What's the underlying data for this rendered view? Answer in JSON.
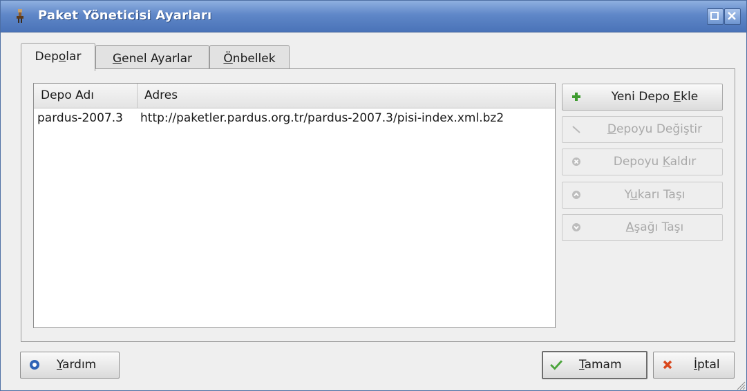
{
  "window": {
    "title": "Paket Yöneticisi Ayarları"
  },
  "tabs": [
    {
      "pre": "Dep",
      "key": "o",
      "post": "lar"
    },
    {
      "pre": "",
      "key": "G",
      "post": "enel Ayarlar"
    },
    {
      "pre": "",
      "key": "Ö",
      "post": "nbellek"
    }
  ],
  "repo_table": {
    "columns": [
      "Depo Adı",
      "Adres"
    ],
    "rows": [
      {
        "name": "pardus-2007.3",
        "address": "http://paketler.pardus.org.tr/pardus-2007.3/pisi-index.xml.bz2"
      }
    ]
  },
  "actions": [
    {
      "pre": "Yeni Depo ",
      "key": "E",
      "post": "kle",
      "icon": "plus-icon",
      "enabled": true
    },
    {
      "pre": "",
      "key": "D",
      "post": "epoyu Değiştir",
      "icon": "edit-icon",
      "enabled": false
    },
    {
      "pre": "Depoyu ",
      "key": "K",
      "post": "aldır",
      "icon": "remove-icon",
      "enabled": false
    },
    {
      "pre": "Y",
      "key": "u",
      "post": "karı Taşı",
      "icon": "arrow-up-icon",
      "enabled": false
    },
    {
      "pre": "",
      "key": "A",
      "post": "şağı Taşı",
      "icon": "arrow-down-icon",
      "enabled": false
    }
  ],
  "footer": {
    "help": {
      "pre": "",
      "key": "Y",
      "post": "ardım"
    },
    "ok": {
      "pre": "",
      "key": "T",
      "post": "amam"
    },
    "cancel": {
      "pre": "",
      "key": "İ",
      "post": "ptal"
    }
  },
  "colors": {
    "titlebar": "#5f87c8",
    "plus": "#3e9b2f",
    "check": "#4aa43a",
    "cross": "#d9471c",
    "help": "#2f63b6"
  }
}
